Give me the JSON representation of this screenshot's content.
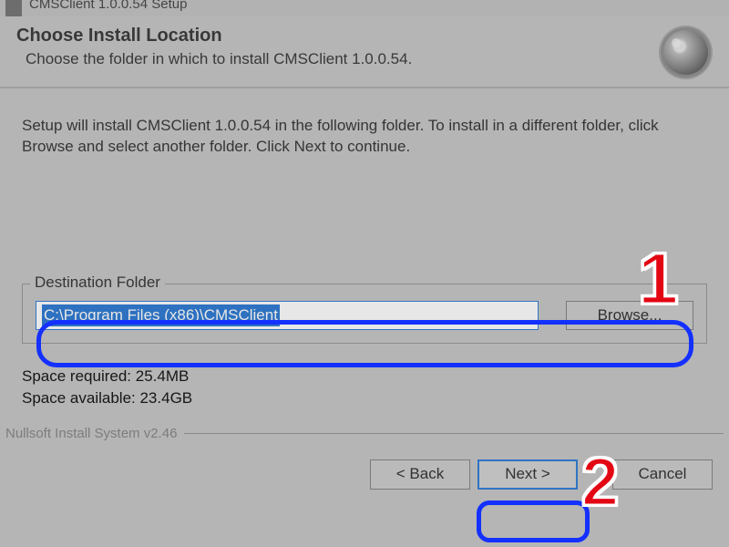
{
  "titlebar": {
    "text": "CMSClient 1.0.0.54 Setup"
  },
  "header": {
    "title": "Choose Install Location",
    "subtitle": "Choose the folder in which to install CMSClient 1.0.0.54."
  },
  "instructions": "Setup will install CMSClient 1.0.0.54 in the following folder. To install in a different folder, click Browse and select another folder. Click Next to continue.",
  "destination": {
    "legend": "Destination Folder",
    "path": "C:\\Program Files (x86)\\CMSClient",
    "browse": "Browse..."
  },
  "space": {
    "required": "Space required: 25.4MB",
    "available": "Space available: 23.4GB"
  },
  "branding": "Nullsoft Install System v2.46",
  "buttons": {
    "back": "< Back",
    "next": "Next >",
    "cancel": "Cancel"
  },
  "annotations": {
    "one": "1",
    "two": "2"
  }
}
